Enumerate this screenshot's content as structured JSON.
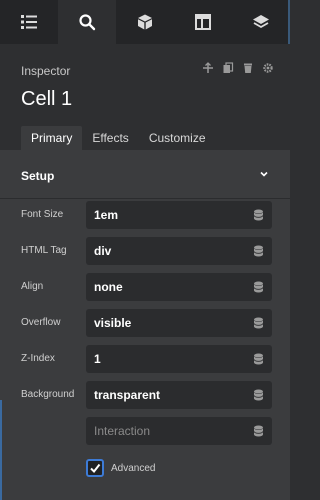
{
  "topbar": {
    "tabs": [
      {
        "icon": "list-icon"
      },
      {
        "icon": "search-icon",
        "active": true
      },
      {
        "icon": "cube-icon"
      },
      {
        "icon": "layout-icon"
      },
      {
        "icon": "layers-icon"
      }
    ]
  },
  "inspector": {
    "label": "Inspector",
    "title": "Cell 1",
    "header_icons": [
      "align-icon",
      "copy-icon",
      "trash-icon",
      "gear-icon"
    ]
  },
  "tabs": [
    {
      "label": "Primary",
      "active": true
    },
    {
      "label": "Effects"
    },
    {
      "label": "Customize"
    }
  ],
  "setup": {
    "title": "Setup",
    "fields": [
      {
        "label": "Font Size",
        "value": "1em"
      },
      {
        "label": "HTML Tag",
        "value": "div"
      },
      {
        "label": "Align",
        "value": "none"
      },
      {
        "label": "Overflow",
        "value": "visible"
      },
      {
        "label": "Z-Index",
        "value": "1"
      },
      {
        "label": "Background",
        "value": "transparent"
      },
      {
        "label": "",
        "placeholder": "Interaction"
      }
    ],
    "advanced_label": "Advanced",
    "advanced_checked": true
  },
  "colors": {
    "accent": "#3d7bd6",
    "panel": "#3b3c3e",
    "field": "#2b2c2e"
  }
}
